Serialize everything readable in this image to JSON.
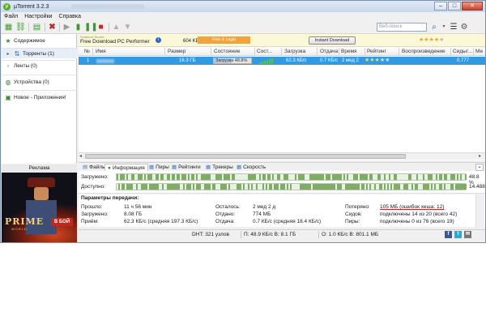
{
  "window": {
    "title": "µTorrent 3.2.3",
    "controls": [
      "–",
      "□",
      "✕"
    ]
  },
  "menu": [
    "Файл",
    "Настройки",
    "Справка"
  ],
  "search": {
    "placeholder": "Веб-поиск"
  },
  "sidebar": {
    "items": [
      {
        "label": "Содержимое",
        "icon": "star-icon"
      },
      {
        "label": "Торренты (1)",
        "icon": "torrents-icon"
      },
      {
        "label": "Ленты (0)",
        "icon": "feed-icon"
      },
      {
        "label": "Устройства (0)",
        "icon": "device-icon"
      },
      {
        "label": "Новое - Приложения!",
        "icon": "apps-icon"
      }
    ]
  },
  "ad": {
    "label": "Реклама",
    "title": "PRIME",
    "subtitle": "WORLD",
    "button": "В БОЙ"
  },
  "banner": {
    "featured": "Featured Torrent",
    "title": "Free Download PC Performer",
    "size": "604 KB",
    "free_label": "Free & Legal",
    "download_button": "Instant Download",
    "rating": 4
  },
  "columns": [
    "№",
    "Имя",
    "Размер",
    "Состояние",
    "Сост...",
    "Загрузка",
    "Отдача",
    "Время",
    "Рейтинг",
    "Воспроизведение",
    "Сиды/...",
    "Ме"
  ],
  "torrent": {
    "num": "1",
    "size": "16.3 ГБ",
    "status": "Загрузка 48.8%",
    "progress": 0.488,
    "down": "62.3 КБ/с",
    "up": "0.7 КБ/с",
    "time": "2 мед 2",
    "rating": 3,
    "ratio": "0.777"
  },
  "tabs": [
    "Файлы",
    "Информация",
    "Пиры",
    "Рейтинги",
    "Трекеры",
    "Скорость"
  ],
  "pieces": {
    "downloaded_label": "Загружено:",
    "downloaded_value": "48.8 %",
    "available_label": "Доступно:",
    "available_value": "14.488"
  },
  "params": {
    "header": "Параметры передачи:",
    "rows": [
      [
        "Прошло:",
        "11 ч 56 мин",
        "Осталось:",
        "2 мед 2 д",
        "Потеряно:",
        "105 МБ (ошибок хеша: 12)"
      ],
      [
        "Загружено:",
        "8.08 ГБ",
        "Отдано:",
        "774 МБ",
        "Сидов:",
        "подключены 14 из 20 (всего 42)"
      ],
      [
        "Приём:",
        "62.3 КБ/с (средняя 197.3 КБ/с)",
        "Отдача:",
        "0.7 КБ/с (средняя 18.4 КБ/с)",
        "Пиры:",
        "подключены 0 из 76 (всего 19)"
      ]
    ]
  },
  "status": {
    "dht": "DHT: 321 узлов",
    "inbound": "П: 48.9 КБ/с В: 8.1 ГБ",
    "outbound": "О: 1.0 КБ/с В: 801.1 МБ"
  }
}
